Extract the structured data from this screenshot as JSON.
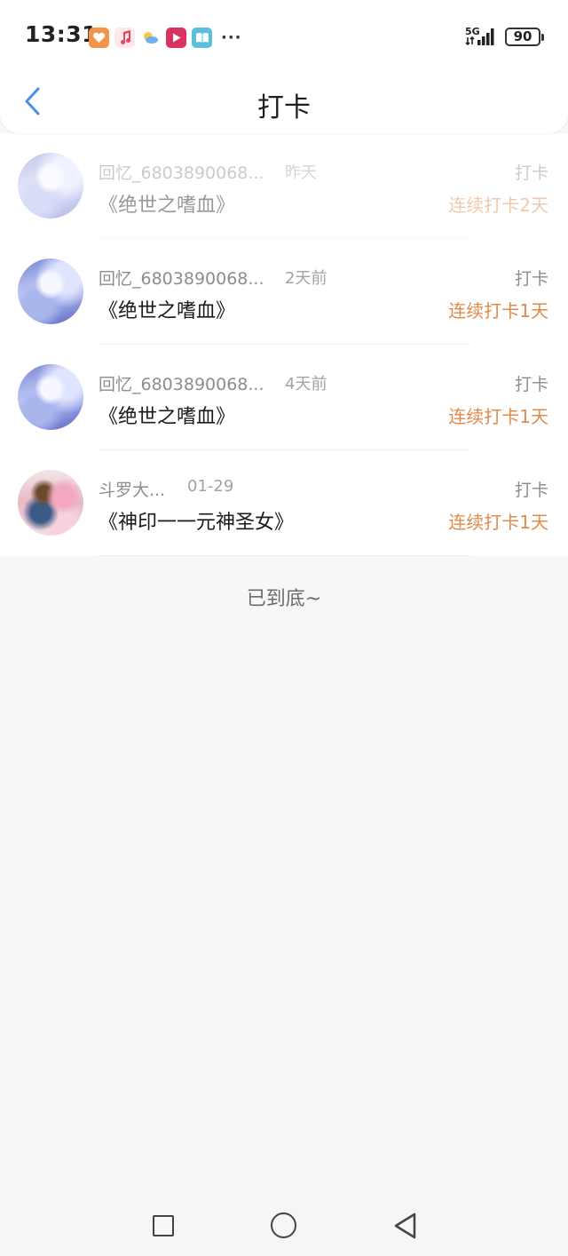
{
  "status_bar": {
    "time": "13:31",
    "network": "5G",
    "battery": "90",
    "more": "···",
    "notification_icons": [
      "tantan-app-icon",
      "music-app-icon",
      "weather-app-icon",
      "video-app-icon",
      "reader-app-icon"
    ]
  },
  "nav": {
    "title": "打卡",
    "back_icon": "chevron-left-icon",
    "accent_color": "#4a90e2"
  },
  "checkins": [
    {
      "username": "回忆_6803890068...",
      "time": "昨天",
      "book": "《绝世之嗜血》",
      "action": "打卡",
      "streak": "连续打卡2天",
      "avatar": "white-hair-girl-avatar",
      "faded": true
    },
    {
      "username": "回忆_6803890068...",
      "time": "2天前",
      "book": "《绝世之嗜血》",
      "action": "打卡",
      "streak": "连续打卡1天",
      "avatar": "white-hair-girl-avatar",
      "faded": false
    },
    {
      "username": "回忆_6803890068...",
      "time": "4天前",
      "book": "《绝世之嗜血》",
      "action": "打卡",
      "streak": "连续打卡1天",
      "avatar": "white-hair-girl-avatar",
      "faded": false
    },
    {
      "username": "斗罗大...",
      "time": "01-29",
      "book": "《神印一一元神圣女》",
      "action": "打卡",
      "streak": "连续打卡1天",
      "avatar": "couple-avatar",
      "faded": false
    }
  ],
  "footer": {
    "end_text": "已到底~"
  },
  "colors": {
    "streak": "#e08a4a",
    "muted": "#8d8d8d",
    "background": "#f8f6f7"
  }
}
